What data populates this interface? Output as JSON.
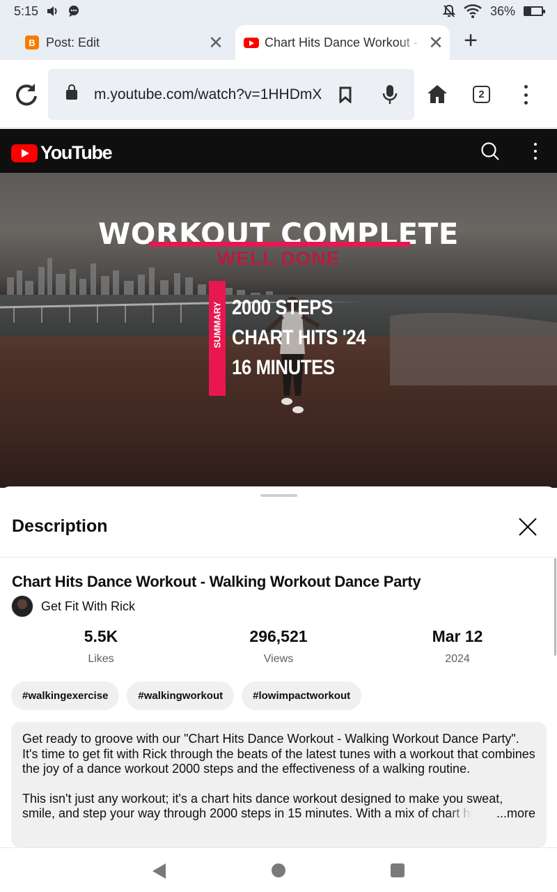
{
  "status_bar": {
    "time": "5:15",
    "battery": "36%"
  },
  "tabs": [
    {
      "title": "Post: Edit",
      "favicon": "blogger-icon"
    },
    {
      "title": "Chart Hits Dance Workout - Walking Workout Dance Party",
      "favicon": "youtube-icon",
      "active": true
    }
  ],
  "browser": {
    "url": "m.youtube.com/watch?v=1HHDmX",
    "tab_count": "2"
  },
  "youtube": {
    "logo_text": "YouTube",
    "brand_color": "#ff0000"
  },
  "video_overlay": {
    "title": "WORKOUT COMPLETE",
    "subtitle": "WELL DONE",
    "summary_label": "SUMMARY",
    "lines": [
      "2000 STEPS",
      "CHART HITS '24",
      "16 MINUTES"
    ],
    "accent_color": "#e8174f"
  },
  "description_sheet": {
    "header": "Description",
    "video_title": "Chart Hits Dance Workout - Walking Workout Dance Party",
    "channel_name": "Get Fit With Rick",
    "stats": [
      {
        "value": "5.5K",
        "label": "Likes"
      },
      {
        "value": "296,521",
        "label": "Views"
      },
      {
        "value": "Mar 12",
        "label": "2024"
      }
    ],
    "hashtags": [
      "#walkingexercise",
      "#walkingworkout",
      "#lowimpactworkout"
    ],
    "paragraph_1": "Get ready to groove with our \"Chart Hits Dance Workout - Walking Workout Dance Party\". It's time to get fit with Rick through the beats of the latest tunes with a workout that combines the joy of a dance workout 2000 steps and the effectiveness of a walking routine.",
    "paragraph_2": "This isn't just any workout; it's a chart hits dance workout designed to make you sweat, smile, and step your way through 2000 steps in 15 minutes. With a mix of chart hits",
    "more_label": "...more"
  }
}
